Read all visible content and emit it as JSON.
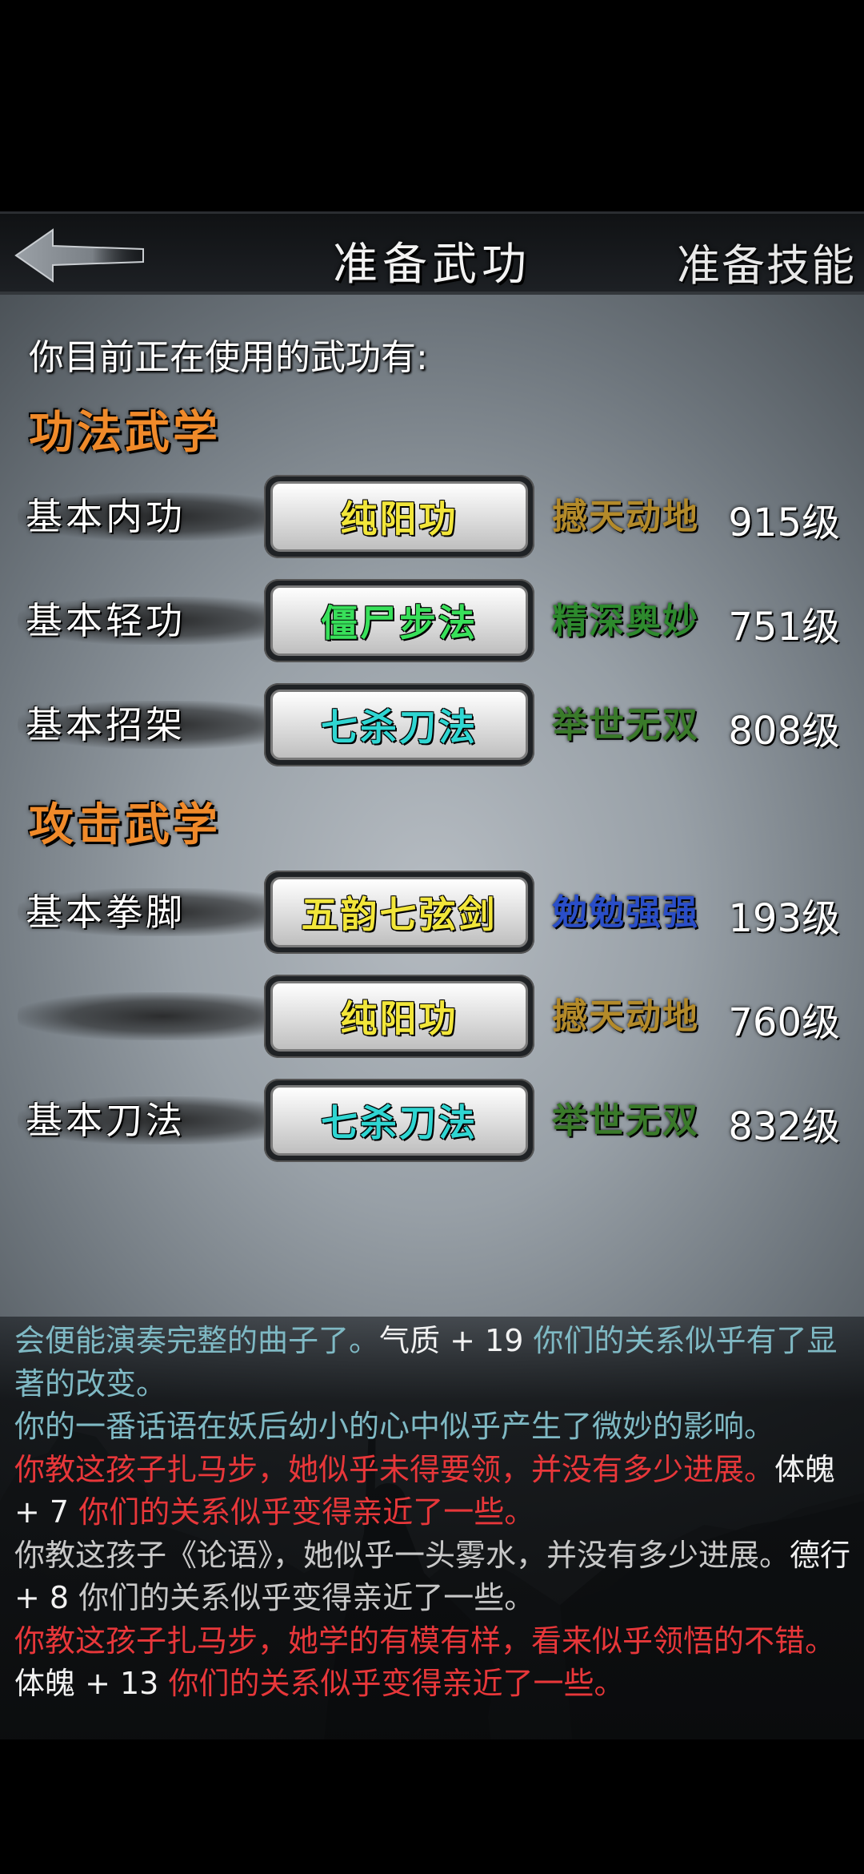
{
  "header": {
    "title": "准备武功",
    "skill_link": "准备技能",
    "back_icon": "arrow-left-icon"
  },
  "intro": "你目前正在使用的武功有:",
  "sections": [
    {
      "title": "功法武学",
      "rows": [
        {
          "slot": "基本内功",
          "skill": "纯阳功",
          "skill_color": "#f2e63a",
          "grade": "撼天动地",
          "grade_color": "#b38a2a",
          "level": "915级"
        },
        {
          "slot": "基本轻功",
          "skill": "僵尸步法",
          "skill_color": "#38e05a",
          "grade": "精深奥妙",
          "grade_color": "#2e8a2e",
          "level": "751级"
        },
        {
          "slot": "基本招架",
          "skill": "七杀刀法",
          "skill_color": "#2fd6d2",
          "grade": "举世无双",
          "grade_color": "#3a7a2a",
          "level": "808级"
        }
      ]
    },
    {
      "title": "攻击武学",
      "rows": [
        {
          "slot": "基本拳脚",
          "skill": "五韵七弦剑",
          "skill_color": "#f2e63a",
          "grade": "勉勉强强",
          "grade_color": "#2a4ec8",
          "level": "193级"
        },
        {
          "slot": "",
          "skill": "纯阳功",
          "skill_color": "#f2e63a",
          "grade": "撼天动地",
          "grade_color": "#b38a2a",
          "level": "760级"
        },
        {
          "slot": "基本刀法",
          "skill": "七杀刀法",
          "skill_color": "#2fd6d2",
          "grade": "举世无双",
          "grade_color": "#3a7a2a",
          "level": "832级"
        }
      ]
    }
  ],
  "log": [
    [
      {
        "t": "会便能演奏完整的曲子了。",
        "c": "teal"
      },
      {
        "t": "气质 + 19",
        "c": "white"
      },
      {
        "t": " 你们的关系似乎有了显著的改变。",
        "c": "teal"
      }
    ],
    [
      {
        "t": "你的一番话语在妖后幼小的心中似乎产生了微妙的影响。",
        "c": "teal"
      }
    ],
    [
      {
        "t": "你教这孩子扎马步，她似乎未得要领，并没有多少进展。",
        "c": "red"
      },
      {
        "t": "体魄 + 7",
        "c": "white"
      },
      {
        "t": " 你们的关系似乎变得亲近了一些。",
        "c": "red"
      }
    ],
    [
      {
        "t": "你教这孩子《论语》，她似乎一头雾水，并没有多少进展。",
        "c": "grey"
      },
      {
        "t": "德行 + 8",
        "c": "white"
      },
      {
        "t": " 你们的关系似乎变得亲近了一些。",
        "c": "grey"
      }
    ],
    [
      {
        "t": "你教这孩子扎马步，她学的有模有样，看来似乎领悟的不错。",
        "c": "red"
      },
      {
        "t": "体魄 + 13",
        "c": "white"
      },
      {
        "t": " 你们的关系似乎变得亲近了一些。",
        "c": "red"
      }
    ]
  ]
}
